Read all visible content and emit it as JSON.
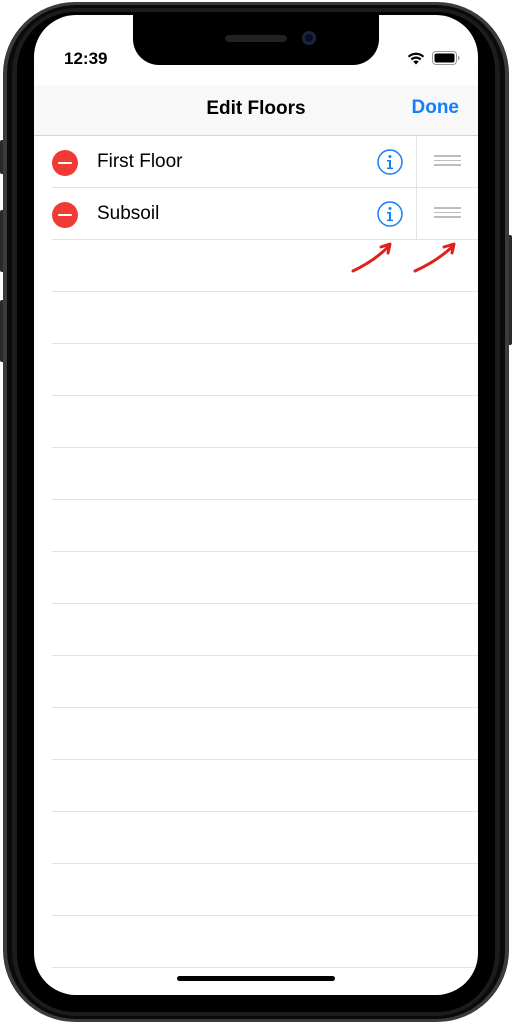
{
  "status_bar": {
    "time": "12:39"
  },
  "nav": {
    "title": "Edit Floors",
    "done_label": "Done"
  },
  "floors": [
    {
      "label": "First Floor"
    },
    {
      "label": "Subsoil"
    }
  ],
  "colors": {
    "accent": "#147efb",
    "delete": "#ef3b33",
    "annotation_arrow": "#e0201d"
  },
  "icons": {
    "delete": "minus-circle-icon",
    "info": "info-circle-icon",
    "reorder": "reorder-grip-icon",
    "wifi": "wifi-icon",
    "battery": "battery-icon"
  }
}
